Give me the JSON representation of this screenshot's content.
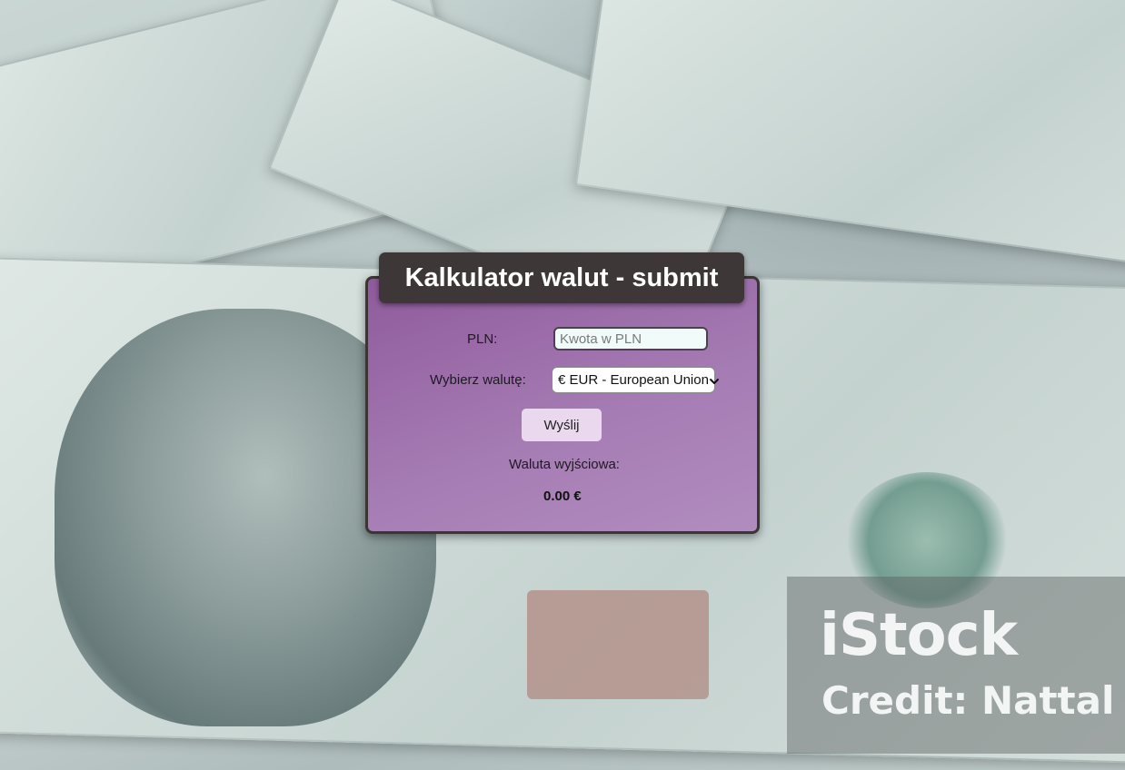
{
  "background": {
    "watermark_logo": "iStock",
    "watermark_credit": "Credit: Nattal"
  },
  "card": {
    "title": "Kalkulator walut - submit",
    "pln_label": "PLN:",
    "pln_input_value": "",
    "pln_input_placeholder": "Kwota w PLN",
    "currency_label": "Wybierz walutę:",
    "currency_selected": "€ EUR - European Union",
    "send_button": "Wyślij",
    "output_label": "Waluta wyjściowa:",
    "output_value": "0.00 €"
  },
  "colors": {
    "card_gradient_start": "#8f5a9c",
    "card_gradient_end": "#b18dbf",
    "title_bar": "#3d3737",
    "button_bg": "#ead9ee",
    "input_bg": "#f0fbfa"
  },
  "icons": {
    "select_arrow": "chevron-down-icon"
  }
}
